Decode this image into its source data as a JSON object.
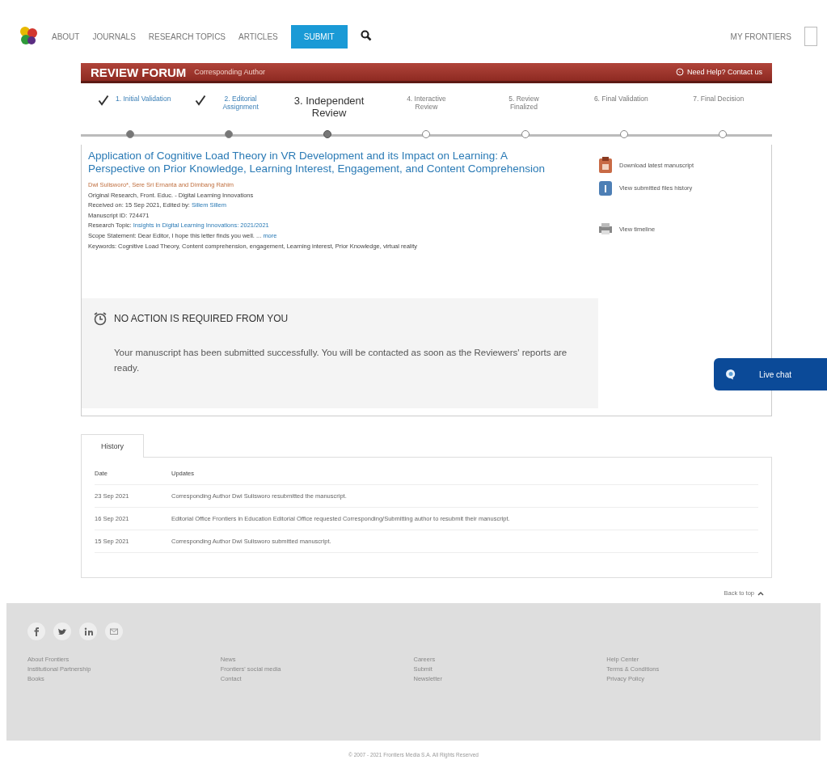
{
  "nav": {
    "items": [
      "ABOUT",
      "JOURNALS",
      "RESEARCH TOPICS",
      "ARTICLES"
    ],
    "submit": "SUBMIT",
    "account": "MY FRONTIERS"
  },
  "forum": {
    "title": "REVIEW FORUM",
    "role": "Corresponding Author",
    "help": "Need Help? Contact us"
  },
  "steps": [
    {
      "label": "1. Initial Validation",
      "done": true,
      "current": false
    },
    {
      "label": "2. Editorial Assignment",
      "done": true,
      "current": false
    },
    {
      "label": "3. Independent Review",
      "done": false,
      "current": true
    },
    {
      "label": "4. Interactive Review",
      "done": false,
      "current": false
    },
    {
      "label": "5. Review Finalized",
      "done": false,
      "current": false
    },
    {
      "label": "6. Final Validation",
      "done": false,
      "current": false
    },
    {
      "label": "7. Final Decision",
      "done": false,
      "current": false
    }
  ],
  "article": {
    "title": "Application of Cognitive Load Theory in VR Development and its Impact on Learning: A Perspective on Prior Knowledge, Learning Interest, Engagement, and Content Comprehension",
    "authors": "Dwi Sulisworo*, Sere Sri Ernanta and Dimbang Rahim",
    "type": "Original Research, Front. Educ. - Digital Learning Innovations",
    "received": "Received on: 15 Sep 2021, Edited by:",
    "editor": "Sillem Sillem",
    "manuscript_id": "Manuscript ID: 724471",
    "topic_label": "Research Topic:",
    "topic": "Insights in Digital Learning Innovations: 2021/2021",
    "scope": "Scope Statement: Dear Editor, I hope this letter finds you well. ...",
    "scope_more": "more",
    "keywords": "Keywords: Cognitive Load Theory, Content comprehension, engagement, Learning interest, Prior Knowledge, virtual reality"
  },
  "actions": [
    {
      "label": "Download latest manuscript",
      "kind": "download"
    },
    {
      "label": "View submitted files history",
      "kind": "history"
    },
    {
      "label": "View timeline",
      "kind": "print"
    }
  ],
  "notice": {
    "title": "NO ACTION IS REQUIRED FROM YOU",
    "message": "Your manuscript has been submitted successfully. You will be contacted as soon as the Reviewers' reports are ready."
  },
  "chat": {
    "label": "Live chat"
  },
  "history": {
    "tabs": [
      {
        "label": "History",
        "selected": true
      }
    ],
    "columns": [
      "Date",
      "Updates"
    ],
    "rows": [
      [
        "23 Sep 2021",
        "Corresponding Author Dwi Sulisworo resubmitted the manuscript."
      ],
      [
        "16 Sep 2021",
        "Editorial Office Frontiers in Education Editorial Office requested Corresponding/Submitting author to resubmit their manuscript."
      ],
      [
        "15 Sep 2021",
        "Corresponding Author Dwi Sulisworo submitted manuscript."
      ]
    ]
  },
  "back_to_top": "Back to top",
  "footer": {
    "social": [
      {
        "kind": "facebook"
      },
      {
        "kind": "twitter"
      },
      {
        "kind": "linkedin"
      },
      {
        "kind": "mail"
      }
    ],
    "columns": [
      [
        "About Frontiers",
        "Institutional Partnership",
        "Books"
      ],
      [
        "News",
        "Frontiers' social media",
        "Contact"
      ],
      [
        "Careers",
        "Submit",
        "Newsletter"
      ],
      [
        "Help Center",
        "Terms & Conditions",
        "Privacy Policy"
      ]
    ],
    "copyright": "© 2007 - 2021 Frontiers Media S.A. All Rights Reserved"
  }
}
